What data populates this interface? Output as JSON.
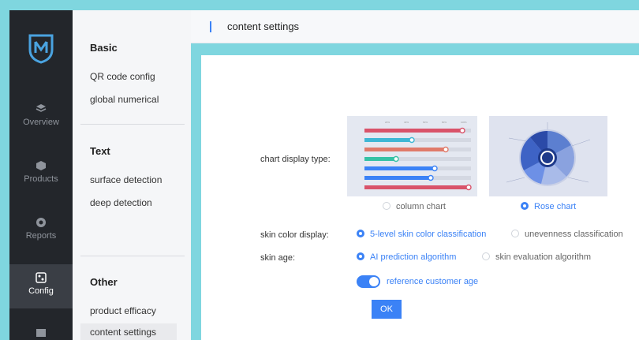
{
  "rail": {
    "items": [
      {
        "label": "Overview",
        "icon": "layers-icon"
      },
      {
        "label": "Products",
        "icon": "box-icon"
      },
      {
        "label": "Reports",
        "icon": "report-icon"
      },
      {
        "label": "Config",
        "icon": "config-icon"
      }
    ]
  },
  "submenu": {
    "basic": {
      "title": "Basic",
      "items": [
        "QR code config",
        "global numerical"
      ]
    },
    "text": {
      "title": "Text",
      "items": [
        "surface detection",
        "deep detection"
      ]
    },
    "other": {
      "title": "Other",
      "items": [
        "product efficacy",
        "content settings"
      ]
    }
  },
  "header": {
    "title": "content settings"
  },
  "form": {
    "chart_display": {
      "label": "chart display type:",
      "options": [
        "column chart",
        "Rose chart"
      ],
      "selected": "Rose chart"
    },
    "skin_color": {
      "label": "skin color display:",
      "options": [
        "5-level skin color classification",
        "unevenness classification"
      ],
      "selected": "5-level skin color classification"
    },
    "skin_age": {
      "label": "skin age:",
      "options": [
        "AI prediction algorithm",
        "skin evaluation algorithm"
      ],
      "selected": "AI prediction algorithm"
    },
    "reference": {
      "label": "reference customer age",
      "enabled": true
    },
    "ok_label": "OK"
  },
  "colors": {
    "accent": "#3b82f6",
    "rail": "#23262b",
    "bg": "#7fd6df"
  }
}
